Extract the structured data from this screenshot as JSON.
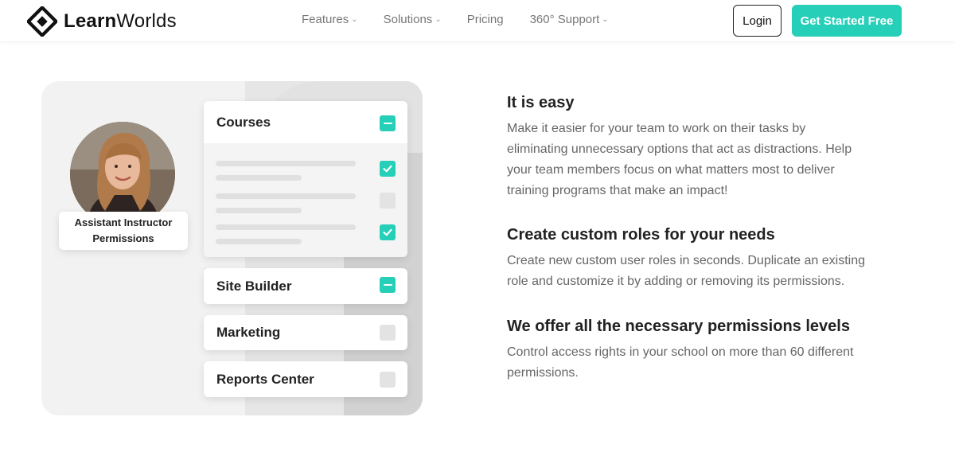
{
  "header": {
    "brand_bold": "Learn",
    "brand_regular": "Worlds",
    "nav": [
      {
        "label": "Features",
        "has_dropdown": true
      },
      {
        "label": "Solutions",
        "has_dropdown": true
      },
      {
        "label": "Pricing",
        "has_dropdown": false
      },
      {
        "label": "360° Support",
        "has_dropdown": true
      }
    ],
    "login_label": "Login",
    "cta_label": "Get Started Free"
  },
  "illustration": {
    "badge_label": "Assistant Instructor Permissions",
    "cards": [
      {
        "title": "Courses",
        "state": "partial"
      },
      {
        "title": "Site Builder",
        "state": "partial"
      },
      {
        "title": "Marketing",
        "state": "unchecked"
      },
      {
        "title": "Reports Center",
        "state": "unchecked"
      }
    ],
    "course_items": [
      {
        "checked": true
      },
      {
        "checked": false
      },
      {
        "checked": true
      }
    ]
  },
  "content": {
    "sections": [
      {
        "title": "It is easy",
        "lines": [
          "Make it easier for your team to work on their tasks by",
          "eliminating unnecessary options that act as distractions. Help",
          "your team members focus on what matters most to deliver",
          "training programs that make an impact!"
        ]
      },
      {
        "title": "Create custom roles for your needs",
        "lines": [
          "Create new custom user roles in seconds. Duplicate an existing",
          "role and customize it by adding or removing its permissions."
        ]
      },
      {
        "title": "We offer all the necessary permissions levels",
        "lines": [
          "Control access rights in your school on more than 60 different",
          "permissions."
        ]
      }
    ]
  },
  "colors": {
    "accent": "#26cfb8",
    "panel_bg": "#f2f2f2",
    "text_dark": "#222222",
    "text_muted": "#666666"
  }
}
